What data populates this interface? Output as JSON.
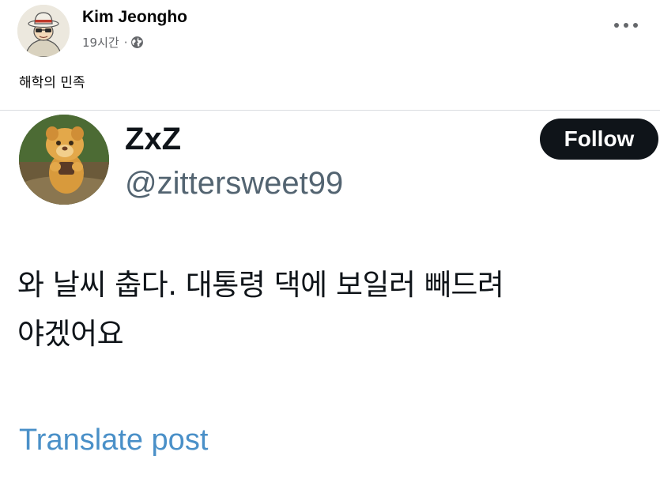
{
  "facebook_post": {
    "author_name": "Kim Jeongho",
    "timestamp": "19시간",
    "separator": "·",
    "privacy_icon": "globe-icon",
    "more_icon": "more-horizontal-icon",
    "caption": "해학의 민족"
  },
  "tweet": {
    "display_name": "ZxZ",
    "handle": "@zittersweet99",
    "follow_label": "Follow",
    "text_line_1": "와 날씨 춥다. 대통령 댁에 보일러 빼드려",
    "text_line_2": "야겠어요",
    "translate_label": "Translate post"
  },
  "colors": {
    "fb_secondary_text": "#65676b",
    "divider": "#dadde1",
    "tweet_text": "#0f1419",
    "tweet_handle": "#536471",
    "follow_button_bg": "#0f1419",
    "translate_link": "#4a90c8"
  }
}
